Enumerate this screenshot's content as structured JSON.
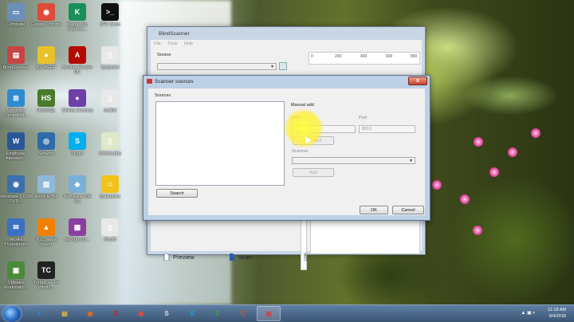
{
  "desktop_icons": [
    {
      "label": "Computer",
      "icon": "computer-icon",
      "glyph": "▭",
      "color": "#6b8fb8"
    },
    {
      "label": "Google Chrome",
      "icon": "chrome-icon",
      "glyph": "◉",
      "color": "#dd4b39"
    },
    {
      "label": "Kaspersky Internet...",
      "icon": "kaspersky-icon",
      "glyph": "K",
      "color": "#1b8f5a"
    },
    {
      "label": "SFC Scan",
      "icon": "cmd-icon",
      "glyph": ">_",
      "color": "#111111"
    },
    {
      "label": "BlindScanner",
      "icon": "blindscanner-icon",
      "glyph": "▤",
      "color": "#c84444"
    },
    {
      "label": "BeeBEEP",
      "icon": "bee-icon",
      "glyph": "●",
      "color": "#e8c22a"
    },
    {
      "label": "Acrobat Reader DC",
      "icon": "acrobat-icon",
      "glyph": "A",
      "color": "#b30b00"
    },
    {
      "label": "1pcportal",
      "icon": "document-icon",
      "glyph": "▯",
      "color": "#e8e8e8"
    },
    {
      "label": "Windows Compatibili...",
      "icon": "windows-icon",
      "glyph": "⊞",
      "color": "#2e8bd1"
    },
    {
      "label": "HeidiSQL",
      "icon": "heidisql-icon",
      "glyph": "HS",
      "color": "#4a7a2a"
    },
    {
      "label": "GitHub Desktop",
      "icon": "github-icon",
      "glyph": "●",
      "color": "#6e3fa8"
    },
    {
      "label": "mailist",
      "icon": "document-icon",
      "glyph": "▯",
      "color": "#e8e8e8"
    },
    {
      "label": "Employee Attendan...",
      "icon": "word-icon",
      "glyph": "W",
      "color": "#2b5797"
    },
    {
      "label": "Network",
      "icon": "network-icon",
      "glyph": "◎",
      "color": "#2e6ba8"
    },
    {
      "label": "Skype",
      "icon": "skype-icon",
      "glyph": "S",
      "color": "#00aff0"
    },
    {
      "label": "remote.php",
      "icon": "php-file-icon",
      "glyph": "▯",
      "color": "#dfe8c8"
    },
    {
      "label": "Windows 7 USB DVD...",
      "icon": "usb-dvd-icon",
      "glyph": "◉",
      "color": "#3a6fb0"
    },
    {
      "label": "Recycle Bin",
      "icon": "recycle-bin-icon",
      "glyph": "▥",
      "color": "#8fb8d8"
    },
    {
      "label": "NetBeans IDE 8.2",
      "icon": "netbeans-icon",
      "glyph": "◆",
      "color": "#7ab0d8"
    },
    {
      "label": "Balaaloika",
      "icon": "smiley-icon",
      "glyph": "☺",
      "color": "#f2c21a"
    },
    {
      "label": "Mozilla Thunderbird",
      "icon": "thunderbird-icon",
      "glyph": "✉",
      "color": "#3b6fc2"
    },
    {
      "label": "VLC media player",
      "icon": "vlc-icon",
      "glyph": "▲",
      "color": "#f08000"
    },
    {
      "label": "backup-car...",
      "icon": "archive-icon",
      "glyph": "▦",
      "color": "#8a3fa0"
    },
    {
      "label": "dcudd",
      "icon": "document-icon",
      "glyph": "▯",
      "color": "#e8e8e8"
    },
    {
      "label": "VMware Workstatio...",
      "icon": "vmware-icon",
      "glyph": "▣",
      "color": "#4a8a3a"
    },
    {
      "label": "TurboC++ for Windo...",
      "icon": "turboc-icon",
      "glyph": "TC",
      "color": "#222222"
    }
  ],
  "blindscanner": {
    "title": "BlindScanner",
    "menu": [
      "File",
      "Tools",
      "Help"
    ],
    "source_label": "Source",
    "ruler_ticks": [
      "0",
      "200",
      "400",
      "600",
      "800"
    ],
    "vruler_tick": "1200",
    "preview_label": "Preview",
    "scan_label": "Scan"
  },
  "dialog": {
    "title": "Scanner sources",
    "sources_label": "Sources",
    "search_label": "Search",
    "manual_add_label": "Manual add",
    "host_label": "Host",
    "port_label": "Port",
    "port_value": "8910",
    "connect_label": "Connect",
    "scanner_label": "Scanner",
    "add_label": "Add",
    "ok_label": "OK",
    "cancel_label": "Cancel",
    "close_glyph": "x"
  },
  "taskbar": {
    "apps": [
      {
        "name": "ie",
        "glyph": "e",
        "color": "#2e8bd1"
      },
      {
        "name": "explorer",
        "glyph": "▤",
        "color": "#e8b84a"
      },
      {
        "name": "firefox",
        "glyph": "◉",
        "color": "#e86a1a"
      },
      {
        "name": "opera",
        "glyph": "O",
        "color": "#d11a1a"
      },
      {
        "name": "chrome",
        "glyph": "◉",
        "color": "#dd4b39"
      },
      {
        "name": "skype-multi",
        "glyph": "S",
        "color": "#e0e0e0"
      },
      {
        "name": "skype",
        "glyph": "S",
        "color": "#00aff0"
      },
      {
        "name": "app-c-green",
        "glyph": "C",
        "color": "#3aa83a"
      },
      {
        "name": "app-c-orange",
        "glyph": "C",
        "color": "#e8531a"
      },
      {
        "name": "blindscanner",
        "glyph": "▤",
        "color": "#c84444"
      }
    ],
    "time": "11:18 AM",
    "date": "9/4/2018"
  }
}
